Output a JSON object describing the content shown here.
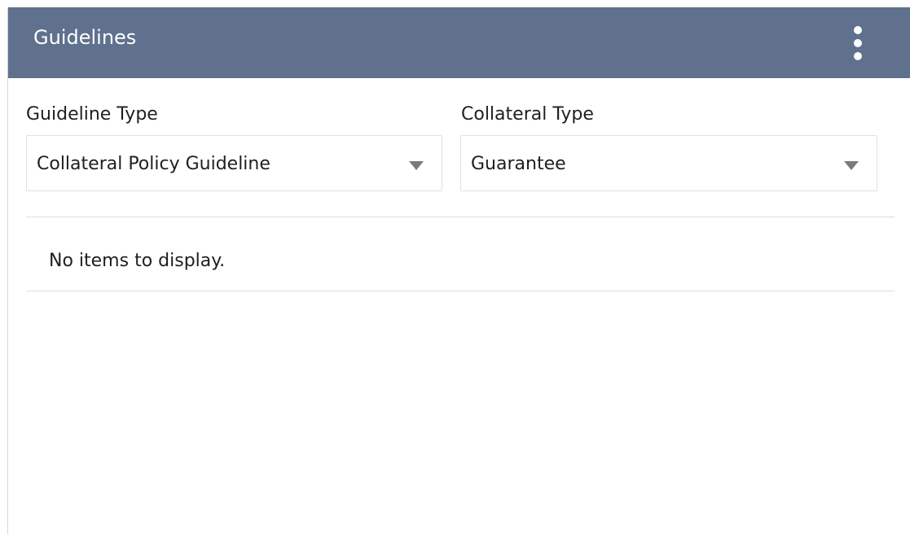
{
  "panel": {
    "title": "Guidelines",
    "menu_icon": "more-vertical-icon"
  },
  "filters": {
    "guideline_type": {
      "label": "Guideline Type",
      "value": "Collateral Policy Guideline"
    },
    "collateral_type": {
      "label": "Collateral Type",
      "value": "Guarantee"
    }
  },
  "list": {
    "empty_message": "No items to display."
  },
  "colors": {
    "header_background": "#5f718c",
    "header_text": "#ffffff"
  }
}
